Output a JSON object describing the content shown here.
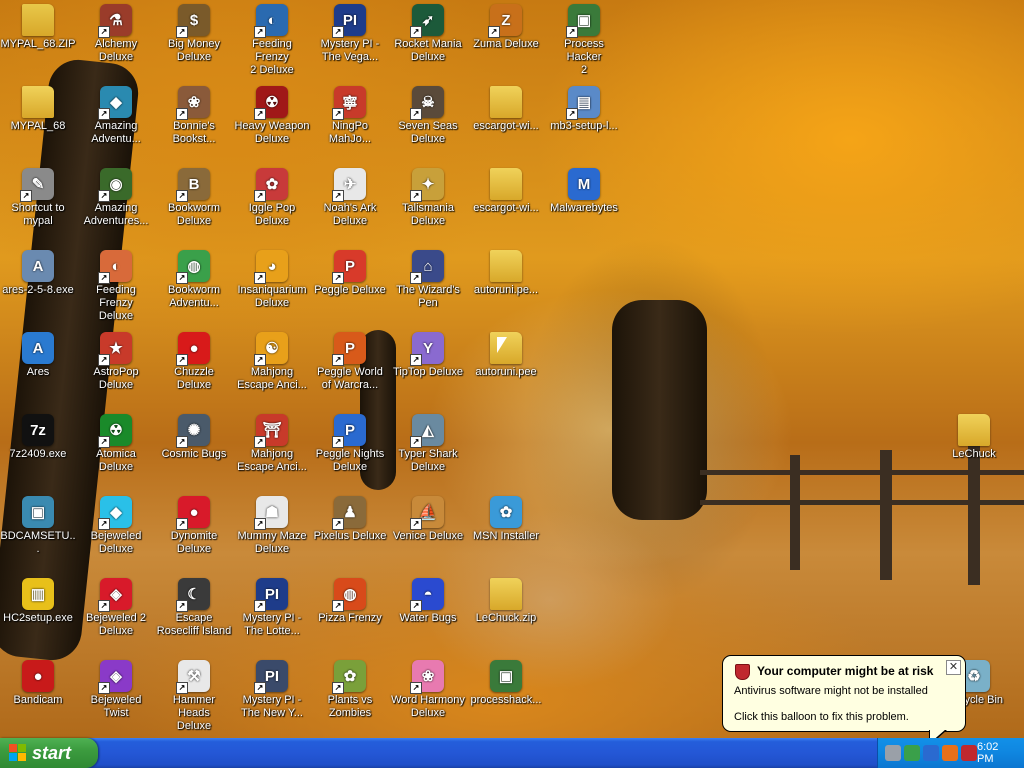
{
  "desktop": {
    "icons": [
      {
        "id": "mypal-zip",
        "label": "MYPAL_68.ZIP",
        "symbol": "",
        "color": "#e8c84a",
        "folder": true,
        "shortcut": false
      },
      {
        "id": "alchemy",
        "label": "Alchemy\nDeluxe",
        "symbol": "⚗",
        "color": "#9a3c2a",
        "shortcut": true
      },
      {
        "id": "big-money",
        "label": "Big Money\nDeluxe",
        "symbol": "$",
        "color": "#7a5a2a",
        "shortcut": true
      },
      {
        "id": "feeding-frenzy-2",
        "label": "Feeding Frenzy\n2 Deluxe",
        "symbol": "◐",
        "color": "#2a6ab0",
        "shortcut": true
      },
      {
        "id": "mystery-pi-vegas",
        "label": "Mystery PI -\nThe Vega...",
        "symbol": "PI",
        "color": "#1e3c8a",
        "shortcut": true
      },
      {
        "id": "rocket-mania",
        "label": "Rocket Mania\nDeluxe",
        "symbol": "➶",
        "color": "#1c5a3a",
        "shortcut": true
      },
      {
        "id": "zuma",
        "label": "Zuma Deluxe",
        "symbol": "Z",
        "color": "#c8701a",
        "shortcut": true
      },
      {
        "id": "process-hacker",
        "label": "Process Hacker\n2",
        "symbol": "▣",
        "color": "#3a7a3a",
        "shortcut": true
      },
      {
        "id": "mypal-folder",
        "label": "MYPAL_68",
        "symbol": "",
        "color": "#f0d25a",
        "folder": true,
        "shortcut": false
      },
      {
        "id": "amazing-adv-1",
        "label": "Amazing\nAdventu...",
        "symbol": "◆",
        "color": "#2a8ab0",
        "shortcut": true
      },
      {
        "id": "bonnies",
        "label": "Bonnie's\nBookst...",
        "symbol": "❀",
        "color": "#8a5a3a",
        "shortcut": true
      },
      {
        "id": "heavy-weapon",
        "label": "Heavy Weapon\nDeluxe",
        "symbol": "☢",
        "color": "#a01818",
        "shortcut": true
      },
      {
        "id": "ningpo",
        "label": "NingPo\nMahJo...",
        "symbol": "寧",
        "color": "#c83a2a",
        "shortcut": true
      },
      {
        "id": "seven-seas",
        "label": "Seven Seas\nDeluxe",
        "symbol": "☠",
        "color": "#5a4a3a",
        "shortcut": true
      },
      {
        "id": "escargot-1",
        "label": "escargot-wi...",
        "symbol": "",
        "color": "#f0d25a",
        "folder": true,
        "shortcut": false
      },
      {
        "id": "mb3-setup",
        "label": "mb3-setup-l...",
        "symbol": "▤",
        "color": "#5a8ac8",
        "shortcut": true
      },
      {
        "id": "shortcut-mypal",
        "label": "Shortcut to\nmypal",
        "symbol": "✎",
        "color": "#8a8a8a",
        "shortcut": true
      },
      {
        "id": "amazing-adv-2",
        "label": "Amazing\nAdventures...",
        "symbol": "◉",
        "color": "#3a6a2a",
        "shortcut": true
      },
      {
        "id": "bookworm",
        "label": "Bookworm\nDeluxe",
        "symbol": "B",
        "color": "#8a6a3a",
        "shortcut": true
      },
      {
        "id": "iggle-pop",
        "label": "Iggle Pop\nDeluxe",
        "symbol": "✿",
        "color": "#c83a3a",
        "shortcut": true
      },
      {
        "id": "noahs-ark",
        "label": "Noah's Ark\nDeluxe",
        "symbol": "✈",
        "color": "#e8e8e8",
        "shortcut": true
      },
      {
        "id": "talismania",
        "label": "Talismania\nDeluxe",
        "symbol": "✦",
        "color": "#c8a03a",
        "shortcut": true
      },
      {
        "id": "escargot-2",
        "label": "escargot-wi...",
        "symbol": "",
        "color": "#f0d25a",
        "folder": true,
        "shortcut": false
      },
      {
        "id": "malwarebytes",
        "label": "Malwarebytes",
        "symbol": "M",
        "color": "#2a6ad0",
        "shortcut": false
      },
      {
        "id": "ares-exe",
        "label": "ares-2-5-8.exe",
        "symbol": "A",
        "color": "#6a8ab0",
        "shortcut": false
      },
      {
        "id": "feeding-frenzy",
        "label": "Feeding Frenzy\nDeluxe",
        "symbol": "◐",
        "color": "#d86a3a",
        "shortcut": true
      },
      {
        "id": "bookworm-adv",
        "label": "Bookworm\nAdventu...",
        "symbol": "◍",
        "color": "#3aa04a",
        "shortcut": true
      },
      {
        "id": "insaniquarium",
        "label": "Insaniquarium\nDeluxe",
        "symbol": "◕",
        "color": "#e8a01a",
        "shortcut": true
      },
      {
        "id": "peggle",
        "label": "Peggle Deluxe",
        "symbol": "P",
        "color": "#d83a2a",
        "shortcut": true
      },
      {
        "id": "wizards-pen",
        "label": "The Wizard's\nPen",
        "symbol": "⌂",
        "color": "#3a4a8a",
        "shortcut": true
      },
      {
        "id": "autoruni-1",
        "label": "autoruni.pe...",
        "symbol": "",
        "color": "#f0d25a",
        "folder": true,
        "shortcut": false
      },
      {
        "id": "ares",
        "label": "Ares",
        "symbol": "A",
        "color": "#2a7ad0",
        "shortcut": false
      },
      {
        "id": "astropop",
        "label": "AstroPop\nDeluxe",
        "symbol": "★",
        "color": "#c83a2a",
        "shortcut": true
      },
      {
        "id": "chuzzle",
        "label": "Chuzzle Deluxe",
        "symbol": "●",
        "color": "#d81a1a",
        "shortcut": true
      },
      {
        "id": "mahjong-1",
        "label": "Mahjong\nEscape Anci...",
        "symbol": "☯",
        "color": "#e8a01a",
        "shortcut": true
      },
      {
        "id": "peggle-wow",
        "label": "Peggle World\nof Warcra...",
        "symbol": "P",
        "color": "#d85a1a",
        "shortcut": true
      },
      {
        "id": "tiptop",
        "label": "TipTop Deluxe",
        "symbol": "Y",
        "color": "#8a6ad0",
        "shortcut": true
      },
      {
        "id": "autoruni-2",
        "label": "autoruni.pee",
        "symbol": "",
        "color": "#f0d25a",
        "folder": true,
        "shortcut": false
      },
      {
        "id": "7z2409",
        "label": "7z2409.exe",
        "symbol": "7z",
        "color": "#111111",
        "shortcut": false
      },
      {
        "id": "atomica",
        "label": "Atomica Deluxe",
        "symbol": "☢",
        "color": "#1a8a2a",
        "shortcut": true
      },
      {
        "id": "cosmic-bugs",
        "label": "Cosmic Bugs",
        "symbol": "✺",
        "color": "#4a5a6a",
        "shortcut": true
      },
      {
        "id": "mahjong-2",
        "label": "Mahjong\nEscape Anci...",
        "symbol": "⛩",
        "color": "#c83a2a",
        "shortcut": true
      },
      {
        "id": "peggle-nights",
        "label": "Peggle Nights\nDeluxe",
        "symbol": "P",
        "color": "#2a6ad0",
        "shortcut": true
      },
      {
        "id": "typer-shark",
        "label": "Typer Shark\nDeluxe",
        "symbol": "◭",
        "color": "#6a8aa0",
        "shortcut": true
      },
      {
        "id": "bdcam-setup",
        "label": "BDCAMSETU...",
        "symbol": "▣",
        "color": "#3a8ab0",
        "shortcut": false
      },
      {
        "id": "bejeweled",
        "label": "Bejeweled\nDeluxe",
        "symbol": "◆",
        "color": "#2ac0e8",
        "shortcut": true
      },
      {
        "id": "dynomite",
        "label": "Dynomite\nDeluxe",
        "symbol": "●",
        "color": "#d81a2a",
        "shortcut": true
      },
      {
        "id": "mummy-maze",
        "label": "Mummy Maze\nDeluxe",
        "symbol": "☗",
        "color": "#e8e8e8",
        "shortcut": true
      },
      {
        "id": "pixelus",
        "label": "Pixelus Deluxe",
        "symbol": "♟",
        "color": "#8a6a3a",
        "shortcut": true
      },
      {
        "id": "venice",
        "label": "Venice Deluxe",
        "symbol": "⛵",
        "color": "#c88a3a",
        "shortcut": true
      },
      {
        "id": "msn-installer",
        "label": "MSN Installer",
        "symbol": "✿",
        "color": "#3a9ad8",
        "shortcut": false
      },
      {
        "id": "hc2setup",
        "label": "HC2setup.exe",
        "symbol": "▥",
        "color": "#e8c01a",
        "shortcut": false
      },
      {
        "id": "bejeweled-2",
        "label": "Bejeweled 2\nDeluxe",
        "symbol": "◈",
        "color": "#d81a2a",
        "shortcut": true
      },
      {
        "id": "escape-rosecliff",
        "label": "Escape\nRosecliff Island",
        "symbol": "☾",
        "color": "#3a3a3a",
        "shortcut": true
      },
      {
        "id": "mystery-pi-lotto",
        "label": "Mystery PI -\nThe Lotte...",
        "symbol": "PI",
        "color": "#1e3c8a",
        "shortcut": true
      },
      {
        "id": "pizza-frenzy",
        "label": "Pizza Frenzy",
        "symbol": "◍",
        "color": "#d84a1a",
        "shortcut": true
      },
      {
        "id": "water-bugs",
        "label": "Water Bugs",
        "symbol": "◓",
        "color": "#2a4ad0",
        "shortcut": true
      },
      {
        "id": "lechuck-zip",
        "label": "LeChuck.zip",
        "symbol": "",
        "color": "#f0d25a",
        "folder": true,
        "shortcut": false
      },
      {
        "id": "bandicam",
        "label": "Bandicam",
        "symbol": "●",
        "color": "#c81a1a",
        "shortcut": false
      },
      {
        "id": "bejeweled-twist",
        "label": "Bejeweled\nTwist",
        "symbol": "◈",
        "color": "#8a3ac8",
        "shortcut": true
      },
      {
        "id": "hammer-heads",
        "label": "Hammer Heads\nDeluxe",
        "symbol": "⚒",
        "color": "#e8e8e8",
        "shortcut": true
      },
      {
        "id": "mystery-pi-new",
        "label": "Mystery PI -\nThe New Y...",
        "symbol": "PI",
        "color": "#3a4a6a",
        "shortcut": true
      },
      {
        "id": "plants-zombies",
        "label": "Plants vs\nZombies",
        "symbol": "✿",
        "color": "#7aa03a",
        "shortcut": true
      },
      {
        "id": "word-harmony",
        "label": "Word Harmony\nDeluxe",
        "symbol": "❀",
        "color": "#e87ab0",
        "shortcut": true
      },
      {
        "id": "processhacker",
        "label": "processhack...",
        "symbol": "▣",
        "color": "#3a7a3a",
        "shortcut": false
      },
      {
        "id": "lechuck",
        "label": "LeChuck",
        "symbol": "",
        "color": "#f0d25a",
        "folder": true,
        "shortcut": false
      },
      {
        "id": "recycle-bin",
        "label": "Recycle Bin",
        "symbol": "♻",
        "color": "#7ab0c8",
        "shortcut": false
      }
    ]
  },
  "balloon": {
    "title": "Your computer might be at risk",
    "line1": "Antivirus software might not be installed",
    "line2": "Click this balloon to fix this problem.",
    "close": "✕"
  },
  "taskbar": {
    "start_label": "start",
    "clock": "6:02 PM",
    "tray_icons": [
      {
        "name": "network-icon",
        "color": "#9aa0a8"
      },
      {
        "name": "update-icon",
        "color": "#3aa04a"
      },
      {
        "name": "malwarebytes-tray-icon",
        "color": "#2a6ad0"
      },
      {
        "name": "firefox-tray-icon",
        "color": "#e8701a"
      },
      {
        "name": "security-shield-icon",
        "color": "#c0282e"
      }
    ]
  }
}
